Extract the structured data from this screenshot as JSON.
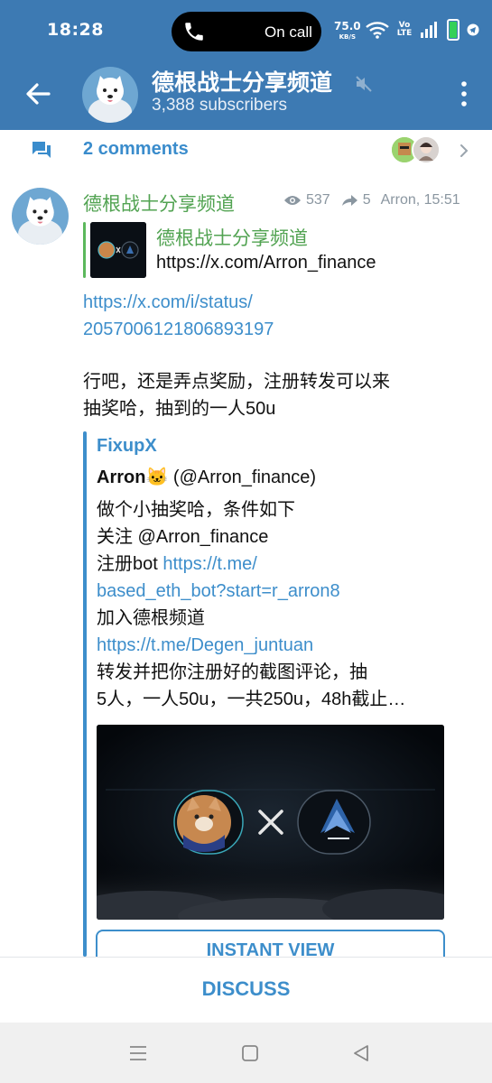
{
  "status_bar": {
    "time": "18:28",
    "call_label": "On call",
    "net_speed": "75.0",
    "net_unit": "KB/S",
    "volte": "Vo LTE"
  },
  "header": {
    "title": "德根战士分享频道",
    "subscribers": "3,388 subscribers"
  },
  "comments": {
    "label": "2 comments"
  },
  "message": {
    "author": "德根战士分享频道",
    "views": "537",
    "forwards": "5",
    "signature_time": "Arron, 15:51",
    "forwarded": {
      "title": "德根战士分享频道",
      "link": "https://x.com/Arron_finance"
    },
    "link_lines": [
      "https://x.com/i/status/",
      "2057006121806893197"
    ],
    "text_lines": [
      "行吧，还是弄点奖励，注册转发可以来",
      "抽奖哈，抽到的一人50u"
    ],
    "preview": {
      "site_name": "FixupX",
      "author_name": "Arron",
      "author_emoji": "🐱",
      "author_handle": "(@Arron_finance)",
      "lines": [
        {
          "text": "做个小抽奖哈，条件如下",
          "link": ""
        },
        {
          "text": "关注 @Arron_finance",
          "link": ""
        },
        {
          "text": "注册bot ",
          "link": "https://t.me/"
        },
        {
          "text": "",
          "link": "based_eth_bot?start=r_arron8"
        },
        {
          "text": "加入德根频道",
          "link": ""
        },
        {
          "text": "",
          "link": "https://t.me/Degen_juntuan"
        },
        {
          "text": "转发并把你注册好的截图评论，抽",
          "link": ""
        },
        {
          "text": "5人，一人50u，一共250u，48h截止…",
          "link": ""
        }
      ],
      "instant_view_label": "INSTANT VIEW"
    }
  },
  "discuss": {
    "label": "DISCUSS"
  },
  "colors": {
    "header_bg": "#3d7ab3",
    "accent_blue": "#3d8ecb",
    "author_green": "#52a352"
  },
  "icons": [
    "back-arrow-icon",
    "muted-speaker-icon",
    "more-vert-icon",
    "comments-icon",
    "chevron-right-icon",
    "eye-icon",
    "share-arrow-icon",
    "phone-icon",
    "wifi-icon",
    "signal-icon",
    "battery-icon",
    "nav-menu-icon",
    "nav-home-icon",
    "nav-back-icon"
  ]
}
